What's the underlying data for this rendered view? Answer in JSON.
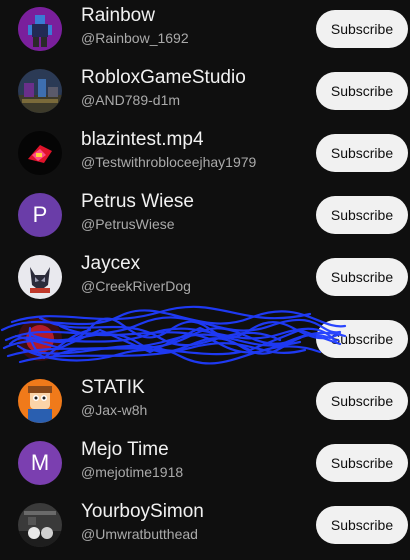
{
  "colors": {
    "background": "#0f0f0f",
    "text_primary": "#f1f1f1",
    "text_secondary": "#aaaaaa",
    "button_bg": "#f1f1f1",
    "button_text": "#0f0f0f",
    "scribble": "#1f3cff",
    "avatar_petrus": "#6a3da8",
    "avatar_mejo": "#7b3fb0"
  },
  "channels": [
    {
      "name": "Rainbow",
      "handle": "@Rainbow_1692",
      "avatar": "roblox-character-avatar",
      "subscribe_label": "Subscribe"
    },
    {
      "name": "RobloxGameStudio",
      "handle": "@AND789-d1m",
      "avatar": "game-scene-avatar",
      "subscribe_label": "Subscribe"
    },
    {
      "name": "blazintest.mp4",
      "handle": "@Testwithrobloceejhay1979",
      "avatar": "dark-artwork-avatar",
      "subscribe_label": "Subscribe"
    },
    {
      "name": "Petrus Wiese",
      "handle": "@PetrusWiese",
      "avatar_letter": "P",
      "subscribe_label": "Subscribe"
    },
    {
      "name": "Jaycex",
      "handle": "@CreekRiverDog",
      "avatar": "wolf-logo-avatar",
      "subscribe_label": "Subscribe"
    },
    {
      "name": "",
      "handle": "",
      "avatar": "scribbled-out-avatar",
      "subscribe_label": "Subscribe"
    },
    {
      "name": "STATIK",
      "handle": "@Jax-w8h",
      "avatar": "cartoon-character-avatar",
      "subscribe_label": "Subscribe"
    },
    {
      "name": "Mejo Time",
      "handle": "@mejotime1918",
      "avatar_letter": "M",
      "subscribe_label": "Subscribe"
    },
    {
      "name": "YourboySimon",
      "handle": "@Umwratbutthead",
      "avatar": "grayscale-photo-avatar",
      "subscribe_label": "Subscribe"
    }
  ]
}
